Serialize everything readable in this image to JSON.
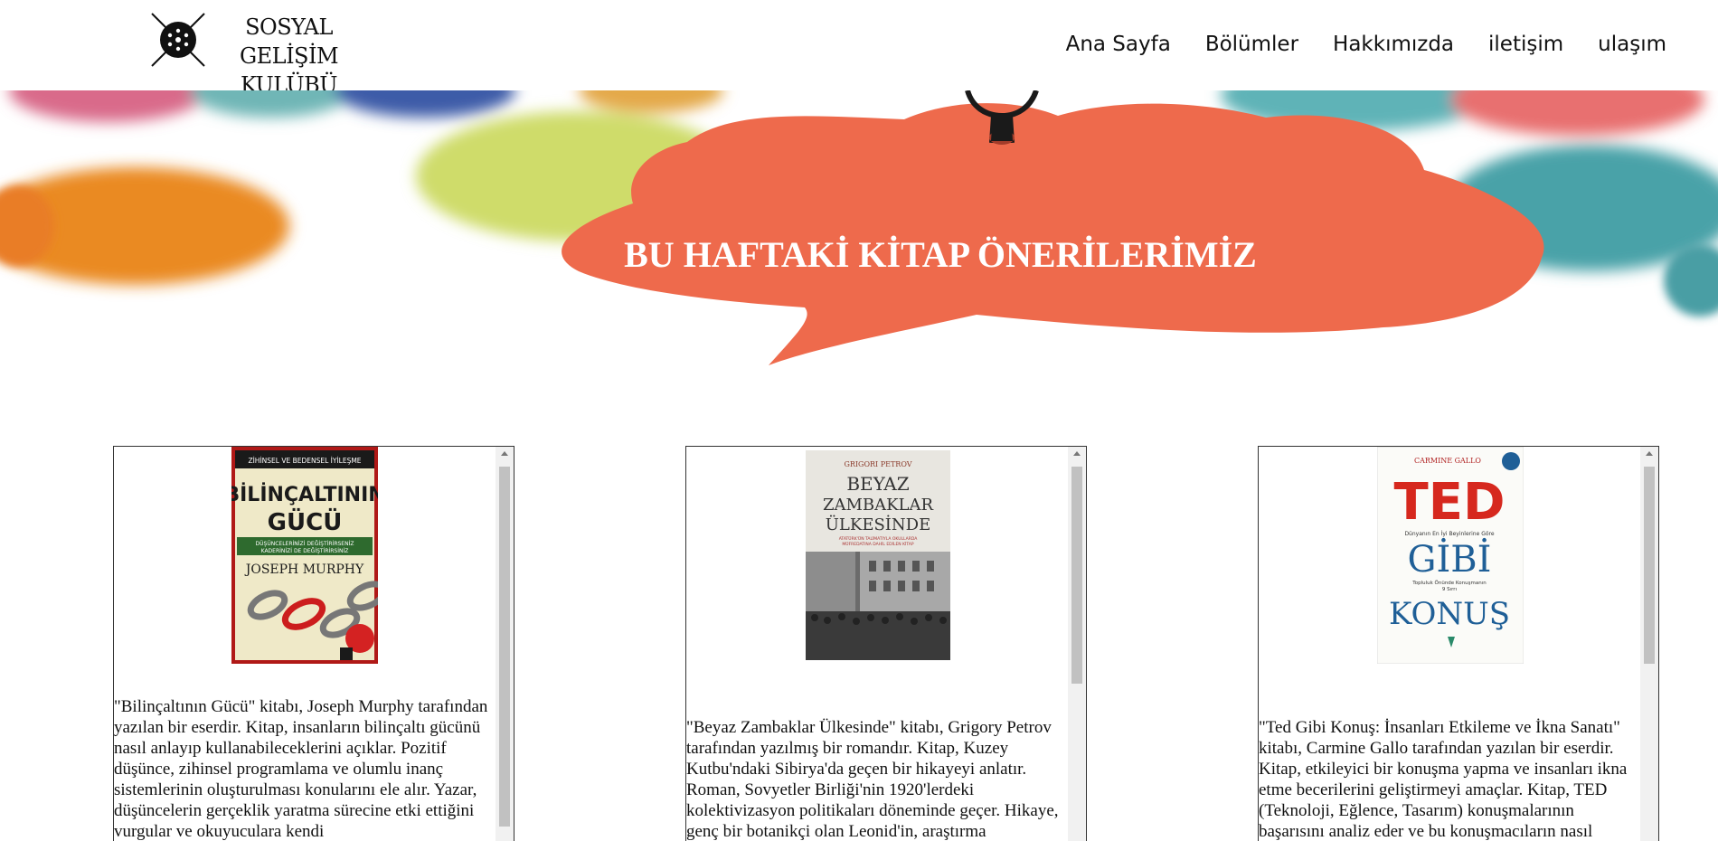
{
  "header": {
    "logo_line1": "SOSYAL GELİŞİM",
    "logo_line2": "KULÜBÜ",
    "nav": [
      {
        "label": "Ana Sayfa"
      },
      {
        "label": "Bölümler"
      },
      {
        "label": "Hakkımızda"
      },
      {
        "label": "iletişim"
      },
      {
        "label": "ulaşım"
      }
    ]
  },
  "hero": {
    "title": "BU HAFTAKİ KİTAP ÖNERİLERİMİZ",
    "bubble_color": "#ee6a4c"
  },
  "cards": [
    {
      "cover": {
        "top_line": "ZİHİNSEL VE BEDENSEL İYİLEŞME",
        "title_line1": "BİLİNÇALTININ",
        "title_line2": "GÜCÜ",
        "subtitle_line1": "DÜŞÜNCELERİNİZİ DEĞİŞTİRİRSENİZ",
        "subtitle_line2": "KADERİNİZİ DE DEĞİŞTİRİRSİNİZ",
        "author": "JOSEPH MURPHY"
      },
      "text": "\"Bilinçaltının Gücü\" kitabı, Joseph Murphy tarafından yazılan bir eserdir. Kitap, insanların bilinçaltı gücünü nasıl anlayıp kullanabileceklerini açıklar. Pozitif düşünce, zihinsel programlama ve olumlu inanç sistemlerinin oluşturulması konularını ele alır. Yazar, düşüncelerin gerçeklik yaratma sürecine etki ettiğini vurgular ve okuyuculara kendi"
    },
    {
      "cover": {
        "author": "GRIGORI PETROV",
        "title_line1": "BEYAZ",
        "title_line2": "ZAMBAKLAR",
        "title_line3": "ÜLKESİNDE",
        "subtitle_line1": "ATATÜRK'ÜN TALİMATIYLA OKULLARDA",
        "subtitle_line2": "MÜFREDATINA DAHİL EDİLEN KİTAP"
      },
      "text": "\"Beyaz Zambaklar Ülkesinde\" kitabı, Grigory Petrov tarafından yazılmış bir romandır. Kitap, Kuzey Kutbu'ndaki Sibirya'da geçen bir hikayeyi anlatır. Roman, Sovyetler Birliği'nin 1920'lerdeki kolektivizasyon politikaları döneminde geçer. Hikaye, genç bir botanikçi olan Leonid'in, araştırma"
    },
    {
      "cover": {
        "author": "CARMINE GALLO",
        "title_line1": "TED",
        "tagline": "Dünyanın En İyi Beyinlerine Göre",
        "title_line2": "GİBİ",
        "tagline2_line1": "Topluluk Önünde Konuşmanın",
        "tagline2_line2": "9 Sırrı",
        "title_line3": "KONUŞ"
      },
      "text": "\"Ted Gibi Konuş: İnsanları Etkileme ve İkna Sanatı\" kitabı, Carmine Gallo tarafından yazılan bir eserdir. Kitap, etkileyici bir konuşma yapma ve insanları ikna etme becerilerini geliştirmeyi amaçlar. Kitap, TED (Teknoloji, Eğlence, Tasarım) konuşmalarının başarısını analiz eder ve bu konuşmacıların nasıl"
    }
  ]
}
